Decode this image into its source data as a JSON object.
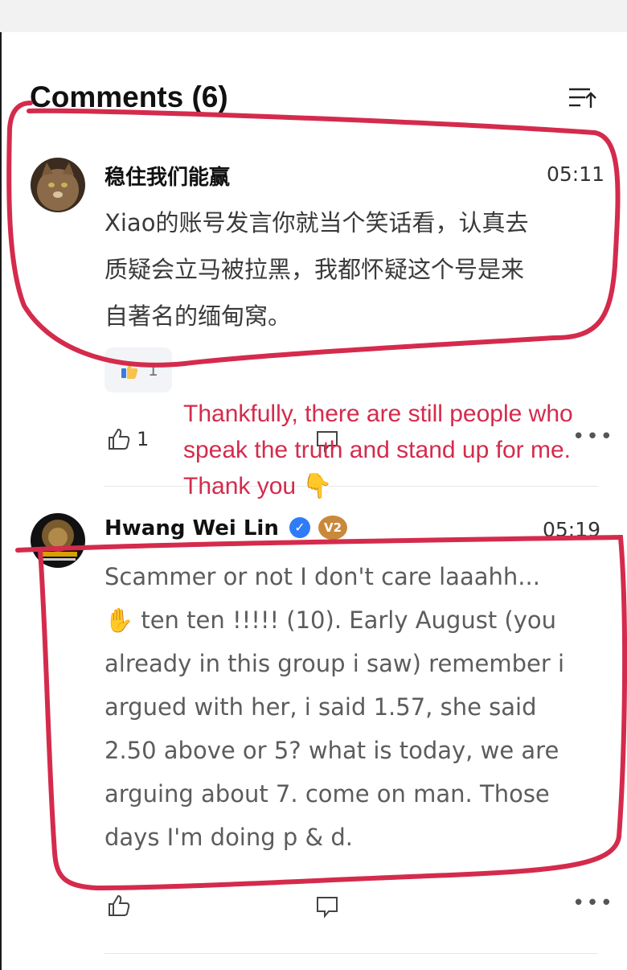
{
  "header": {
    "title": "Comments (6)",
    "sort_icon": "sort-icon"
  },
  "comments": [
    {
      "username": "稳住我们能赢",
      "time": "05:11",
      "text": "Xiao的账号发言你就当个笑话看，认真去\n质疑会立马被拉黑，我都怀疑这个号是来\n自著名的缅甸窝。",
      "reaction_count": "1",
      "likes": "1"
    },
    {
      "username": "Hwang Wei Lin",
      "time": "05:19",
      "text": "Scammer or not I don't care laaahh...\n✋ ten ten !!!!! (10). Early August (you\nalready in this group i saw) remember i\nargued with her, i said 1.57, she said\n2.50 above or 5? what is today, we are\narguing about 7. come on man. Those\ndays I'm doing p & d.",
      "badge_level": "V2"
    }
  ],
  "annotation": {
    "text": "Thankfully, there are still people who speak the truth and stand up for me. Thank you 👇"
  },
  "colors": {
    "annotation_red": "#d42b4c",
    "verified_blue": "#2f7cf6"
  }
}
